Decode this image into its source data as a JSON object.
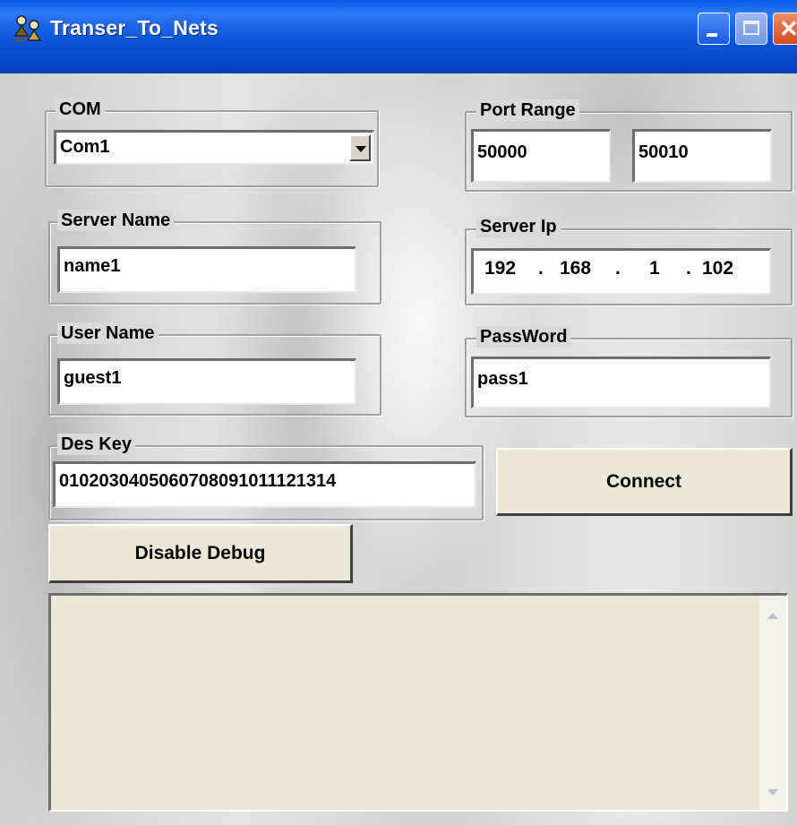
{
  "window": {
    "title": "Transer_To_Nets"
  },
  "com": {
    "label": "COM",
    "selected": "Com1"
  },
  "port_range": {
    "label": "Port Range",
    "start": "50000",
    "end": "50010"
  },
  "server_name": {
    "label": "Server Name",
    "value": "name1"
  },
  "server_ip": {
    "label": "Server Ip",
    "octets": [
      "192",
      "168",
      "1",
      "102"
    ],
    "separator": "."
  },
  "user_name": {
    "label": "User Name",
    "value": "guest1"
  },
  "password": {
    "label": "PassWord",
    "value": "pass1"
  },
  "des_key": {
    "label": "Des Key",
    "value": "0102030405060708091011121314"
  },
  "buttons": {
    "connect": "Connect",
    "debug": "Disable Debug"
  },
  "log": {
    "text": ""
  },
  "colors": {
    "titlebar": "#0a5de8",
    "button_face": "#ece9d8",
    "close_button": "#d24a1f"
  },
  "icons": {
    "app": "network-app-icon",
    "minimize": "minimize-icon",
    "maximize": "maximize-icon",
    "close": "close-icon",
    "dropdown": "chevron-down-icon",
    "scroll_up": "scroll-up-icon",
    "scroll_down": "scroll-down-icon"
  }
}
